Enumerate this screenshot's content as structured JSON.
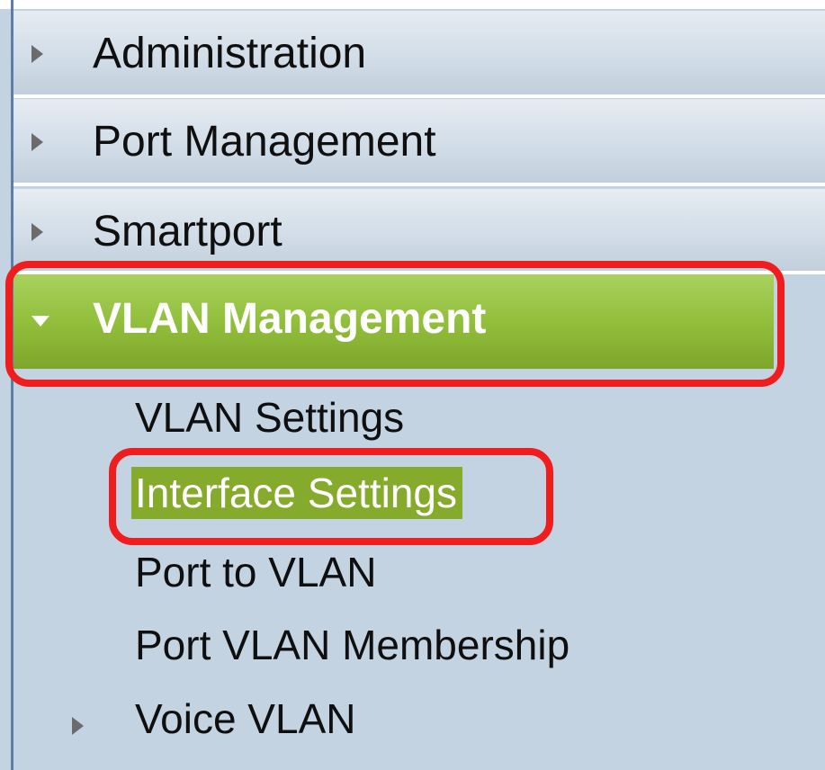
{
  "menu": {
    "items": [
      {
        "label": "Administration",
        "icon": "triangle-right-icon"
      },
      {
        "label": "Port Management",
        "icon": "triangle-right-icon"
      },
      {
        "label": "Smartport",
        "icon": "triangle-right-icon"
      },
      {
        "label": "VLAN Management",
        "icon": "triangle-down-icon",
        "expanded": true
      }
    ],
    "subitems": [
      {
        "label": "VLAN Settings"
      },
      {
        "label": "Interface Settings",
        "selected": true
      },
      {
        "label": "Port to VLAN"
      },
      {
        "label": "Port VLAN Membership"
      },
      {
        "label": "Voice VLAN",
        "icon": "triangle-right-icon"
      }
    ]
  },
  "colors": {
    "active_green": "#92bf3c",
    "selected_green": "#86aa2c",
    "highlight_red": "#ef1d1d",
    "panel_blue": "#c4d3e2"
  }
}
